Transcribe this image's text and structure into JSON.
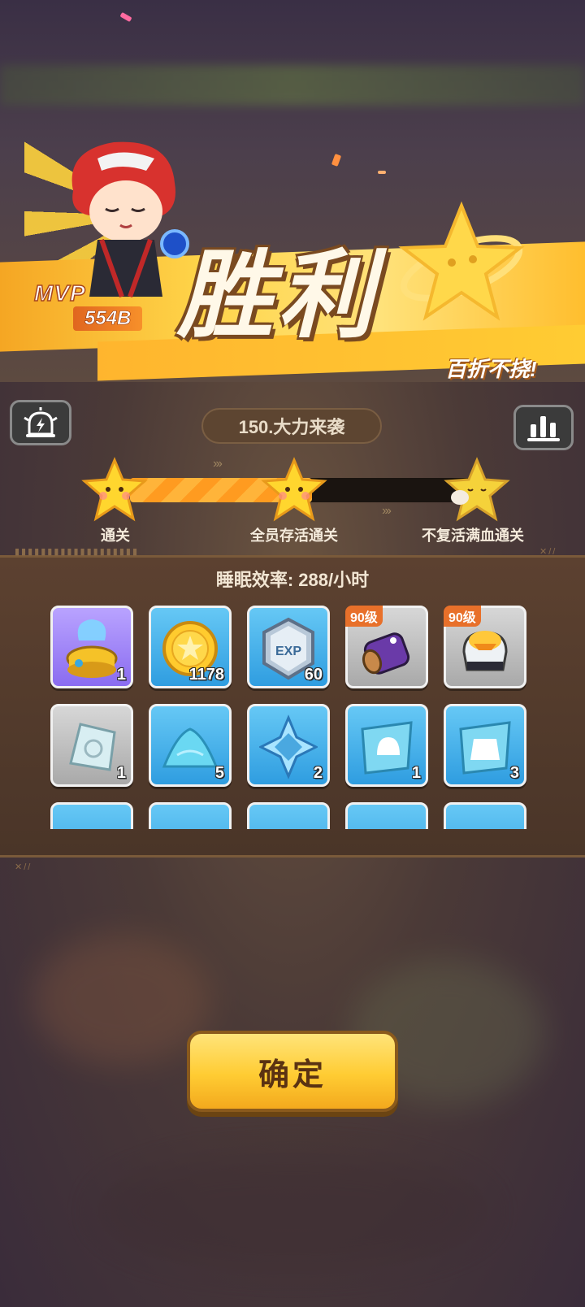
{
  "banner": {
    "mvp_label": "MVP",
    "mvp_value": "554B",
    "title": "胜利",
    "subtitle": "百折不挠!"
  },
  "header": {
    "left_icon": "alarm-lightning-icon",
    "stage_name": "150.大力来袭",
    "right_icon": "bar-chart-icon"
  },
  "progress": {
    "fill_fraction": 0.52,
    "milestones": [
      {
        "label": "通关",
        "achieved": true
      },
      {
        "label": "全员存活通关",
        "achieved": true
      },
      {
        "label": "不复活满血通关",
        "achieved": false
      }
    ]
  },
  "rewards": {
    "sleep_efficiency": "睡眠效率: 288/小时",
    "items": [
      {
        "name": "energy-core",
        "count": "1",
        "level": "",
        "rarity": "purple"
      },
      {
        "name": "gold-coin",
        "count": "1178",
        "level": "",
        "rarity": "blue"
      },
      {
        "name": "exp-badge",
        "count": "60",
        "level": "",
        "rarity": "blue"
      },
      {
        "name": "purple-cannon",
        "count": "",
        "level": "90级",
        "rarity": "gray"
      },
      {
        "name": "duck-armor",
        "count": "",
        "level": "90级",
        "rarity": "gray"
      },
      {
        "name": "crystal-shard",
        "count": "1",
        "level": "",
        "rarity": "gray"
      },
      {
        "name": "blue-sand",
        "count": "5",
        "level": "",
        "rarity": "blue"
      },
      {
        "name": "rune-chip",
        "count": "2",
        "level": "",
        "rarity": "blue"
      },
      {
        "name": "blueprint-helmet",
        "count": "1",
        "level": "",
        "rarity": "blue"
      },
      {
        "name": "blueprint-armor",
        "count": "3",
        "level": "",
        "rarity": "blue"
      }
    ]
  },
  "confirm_label": "确定",
  "colors": {
    "accent": "#ffcc33",
    "progress": "#ff9b20",
    "panel": "#5c4130"
  }
}
